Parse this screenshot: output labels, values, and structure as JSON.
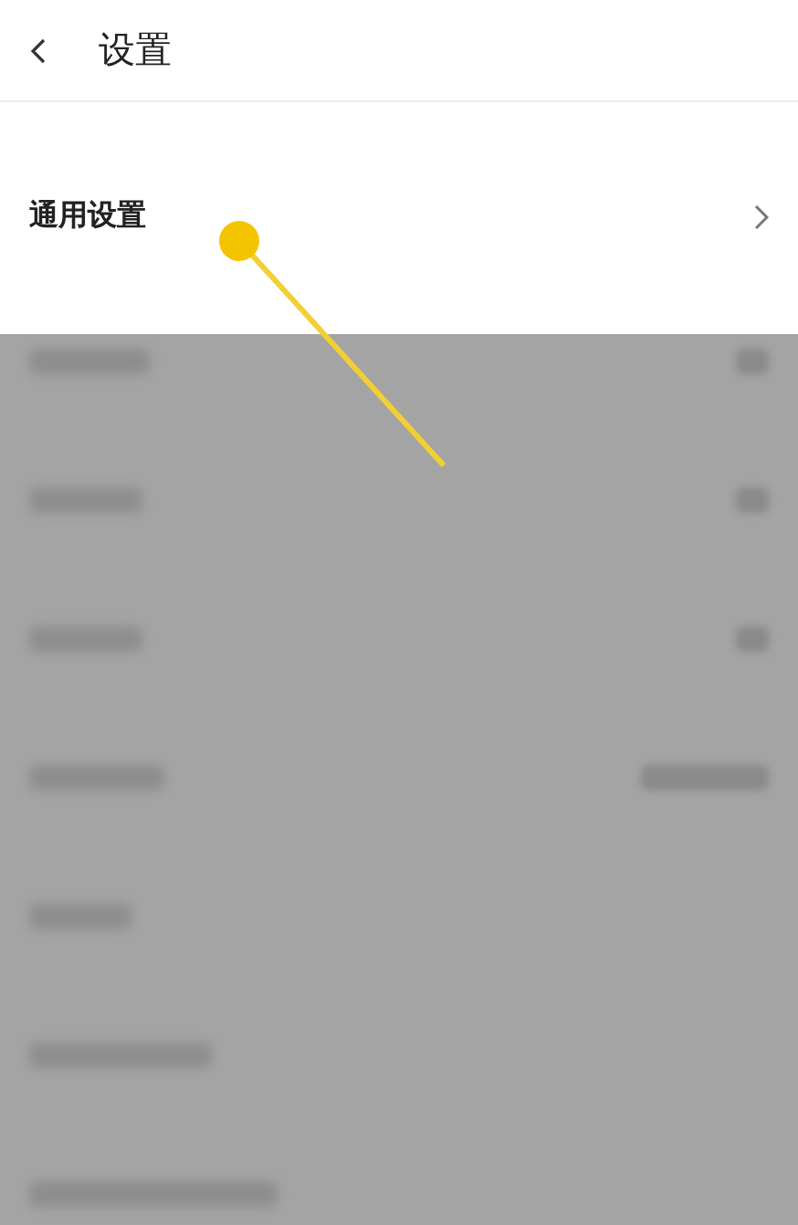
{
  "header": {
    "title": "设置"
  },
  "settings": [
    {
      "label": "通用设置"
    }
  ]
}
